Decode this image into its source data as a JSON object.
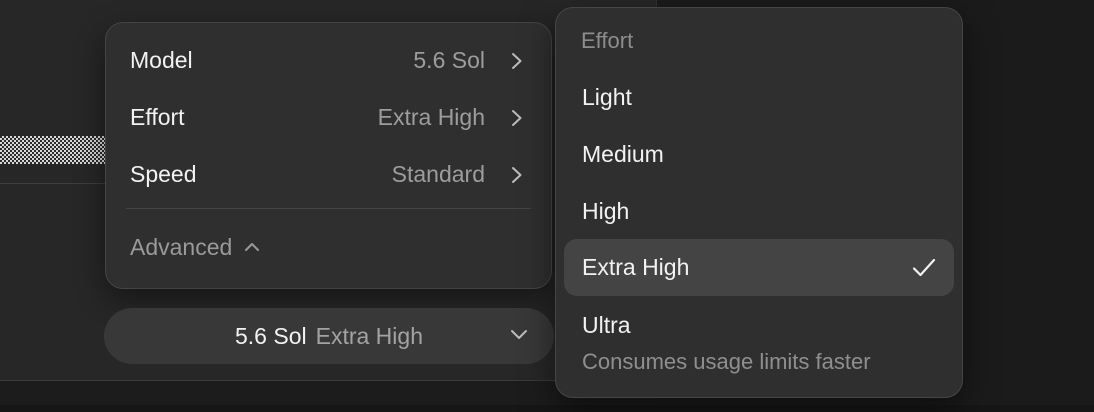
{
  "menu": {
    "items": [
      {
        "label": "Model",
        "value": "5.6 Sol"
      },
      {
        "label": "Effort",
        "value": "Extra High"
      },
      {
        "label": "Speed",
        "value": "Standard"
      }
    ],
    "advanced_label": "Advanced"
  },
  "pill": {
    "model": "5.6 Sol",
    "effort": "Extra High"
  },
  "effort_menu": {
    "header": "Effort",
    "options": [
      {
        "label": "Light",
        "selected": false
      },
      {
        "label": "Medium",
        "selected": false
      },
      {
        "label": "High",
        "selected": false
      },
      {
        "label": "Extra High",
        "selected": true
      },
      {
        "label": "Ultra",
        "selected": false,
        "note": "Consumes usage limits faster"
      }
    ]
  },
  "colors": {
    "menu_bg": "#2f2f2f",
    "selected_bg": "#444444",
    "text_primary": "#f2f2f2",
    "text_secondary": "#9d9d9d"
  },
  "icons": {
    "row_chevron": "chevron-right-icon",
    "advanced_caret": "chevron-up-icon",
    "pill_chevron": "chevron-down-icon",
    "selected_mark": "checkmark-icon"
  }
}
